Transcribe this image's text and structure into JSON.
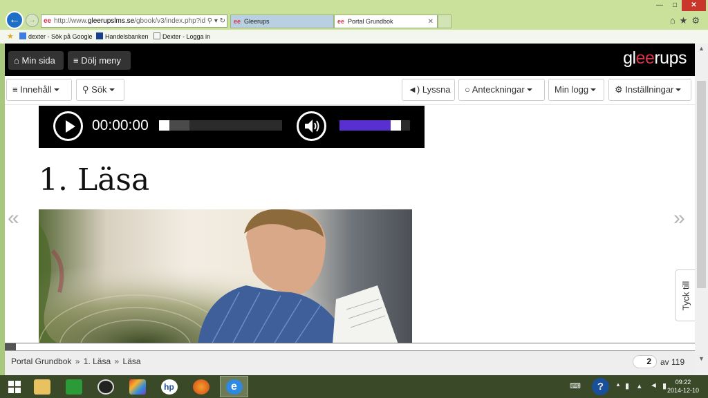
{
  "browser": {
    "address_prefix": "http://www.",
    "address_host": "gleerupslms.se",
    "address_path": "/gbook/v3/index.php?id=",
    "tabs": [
      {
        "label": "Gleerups"
      },
      {
        "label": "Portal Grundbok"
      }
    ],
    "favorites": [
      {
        "label": "dexter - Sök på Google"
      },
      {
        "label": "Handelsbanken"
      },
      {
        "label": "Dexter - Logga in"
      }
    ]
  },
  "header": {
    "min_sida": "Min sida",
    "dolj_meny": "Dölj meny",
    "brand_pre": "gl",
    "brand_accent": "ee",
    "brand_post": "rups"
  },
  "toolbar": {
    "innehall": "Innehåll",
    "sok": "Sök",
    "lyssna": "Lyssna",
    "anteckningar": "Anteckningar",
    "min_logg": "Min logg",
    "installningar": "Inställningar"
  },
  "player": {
    "time": "00:00:00",
    "progress": 0.0,
    "buffered": 0.18,
    "volume": 0.85,
    "volume_color": "#5a2fd0"
  },
  "content": {
    "heading": "1. Läsa",
    "prev_arrow": "«",
    "next_arrow": "»",
    "feedback": "Tyck till",
    "reading_progress": 0.016
  },
  "footer": {
    "crumbs": [
      "Portal Grundbok",
      "1. Läsa",
      "Läsa"
    ],
    "separator": "»",
    "page_current": "2",
    "page_total": "av 119"
  },
  "taskbar": {
    "clock_time": "09:22",
    "clock_date": "2014-12-10"
  },
  "colors": {
    "accent": "#d8334a",
    "topbar": "#000000"
  }
}
